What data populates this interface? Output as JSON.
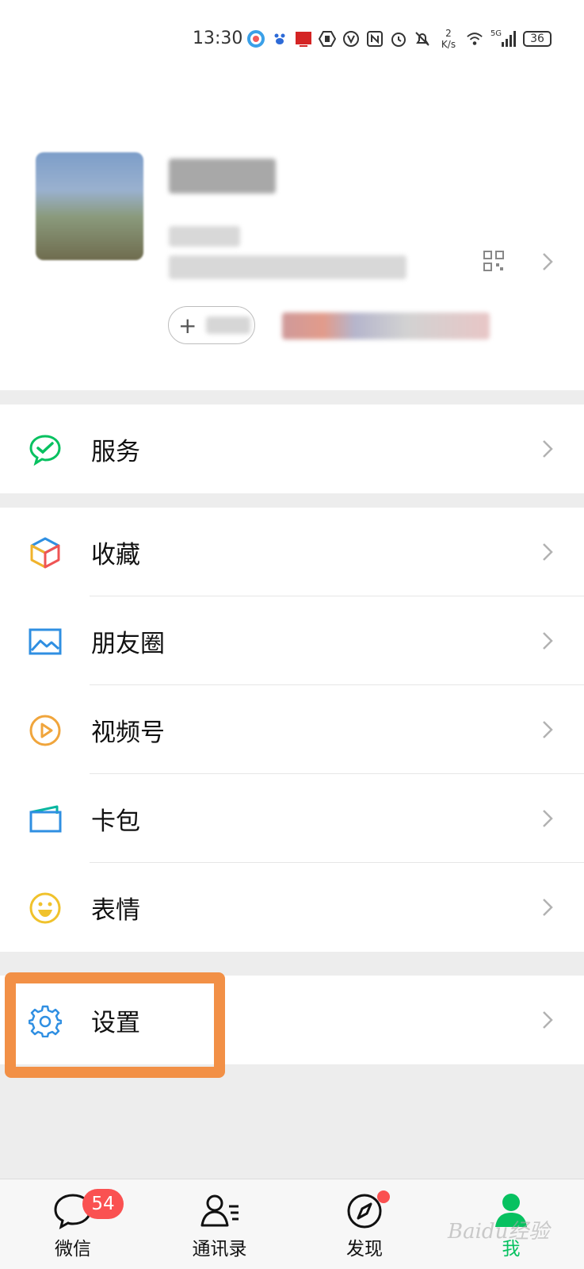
{
  "status_bar": {
    "time": "13:30",
    "network_speed_value": "2",
    "network_speed_unit": "K/s",
    "network_type": "5G",
    "battery": "36"
  },
  "profile": {
    "status_add_symbol": "+"
  },
  "menu": {
    "service": "服务",
    "favorites": "收藏",
    "moments": "朋友圈",
    "channels": "视频号",
    "card_wallet": "卡包",
    "stickers": "表情",
    "settings": "设置"
  },
  "tabbar": {
    "chats": "微信",
    "chats_badge": "54",
    "contacts": "通讯录",
    "discover": "发现",
    "me": "我"
  },
  "watermark": "Baidu经验",
  "colors": {
    "accent_green": "#07c160",
    "badge_red": "#fa5151",
    "highlight_orange": "#f29046"
  }
}
